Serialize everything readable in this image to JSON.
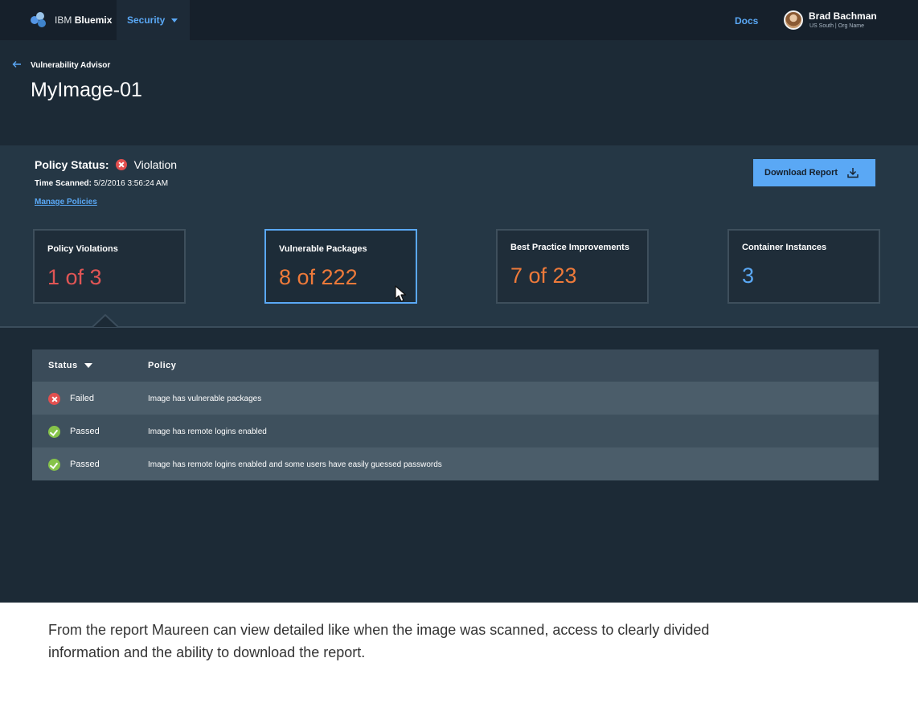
{
  "topbar": {
    "brand_prefix": "IBM",
    "brand_name": "Bluemix",
    "nav_label": "Security",
    "docs_label": "Docs",
    "user_name": "Brad Bachman",
    "user_org": "US South | Org Name"
  },
  "header": {
    "breadcrumb": "Vulnerability Advisor",
    "title": "MyImage-01"
  },
  "summary": {
    "policy_status_label": "Policy Status:",
    "policy_status_value": "Violation",
    "time_scanned_label": "Time Scanned:",
    "time_scanned_value": "5/2/2016 3:56:24 AM",
    "manage_policies": "Manage Policies",
    "download_label": "Download Report",
    "cards": [
      {
        "label": "Policy Violations",
        "value": "1 of 3",
        "color": "#e05555"
      },
      {
        "label": "Vulnerable Packages",
        "value": "8 of 222",
        "color": "#ee7a3a"
      },
      {
        "label": "Best Practice Improvements",
        "value": "7 of 23",
        "color": "#ee7a3a"
      },
      {
        "label": "Container Instances",
        "value": "3",
        "color": "#5aa8f5"
      }
    ]
  },
  "table": {
    "headers": {
      "status": "Status",
      "policy": "Policy"
    },
    "rows": [
      {
        "status": "Failed",
        "policy": "Image has vulnerable packages",
        "icon": "x-circle-icon"
      },
      {
        "status": "Passed",
        "policy": "Image has remote logins enabled",
        "icon": "check-circle-icon"
      },
      {
        "status": "Passed",
        "policy": "Image has remote logins enabled and some users have easily guessed passwords",
        "icon": "check-circle-icon"
      }
    ]
  },
  "caption": {
    "text": "From the report Maureen can view detailed like when the image was scanned, access to clearly divided information and the ability to download the report."
  },
  "colors": {
    "accent": "#5aa8f5",
    "danger": "#e24f4f",
    "success": "#86c34a",
    "warning": "#ee7a3a"
  }
}
